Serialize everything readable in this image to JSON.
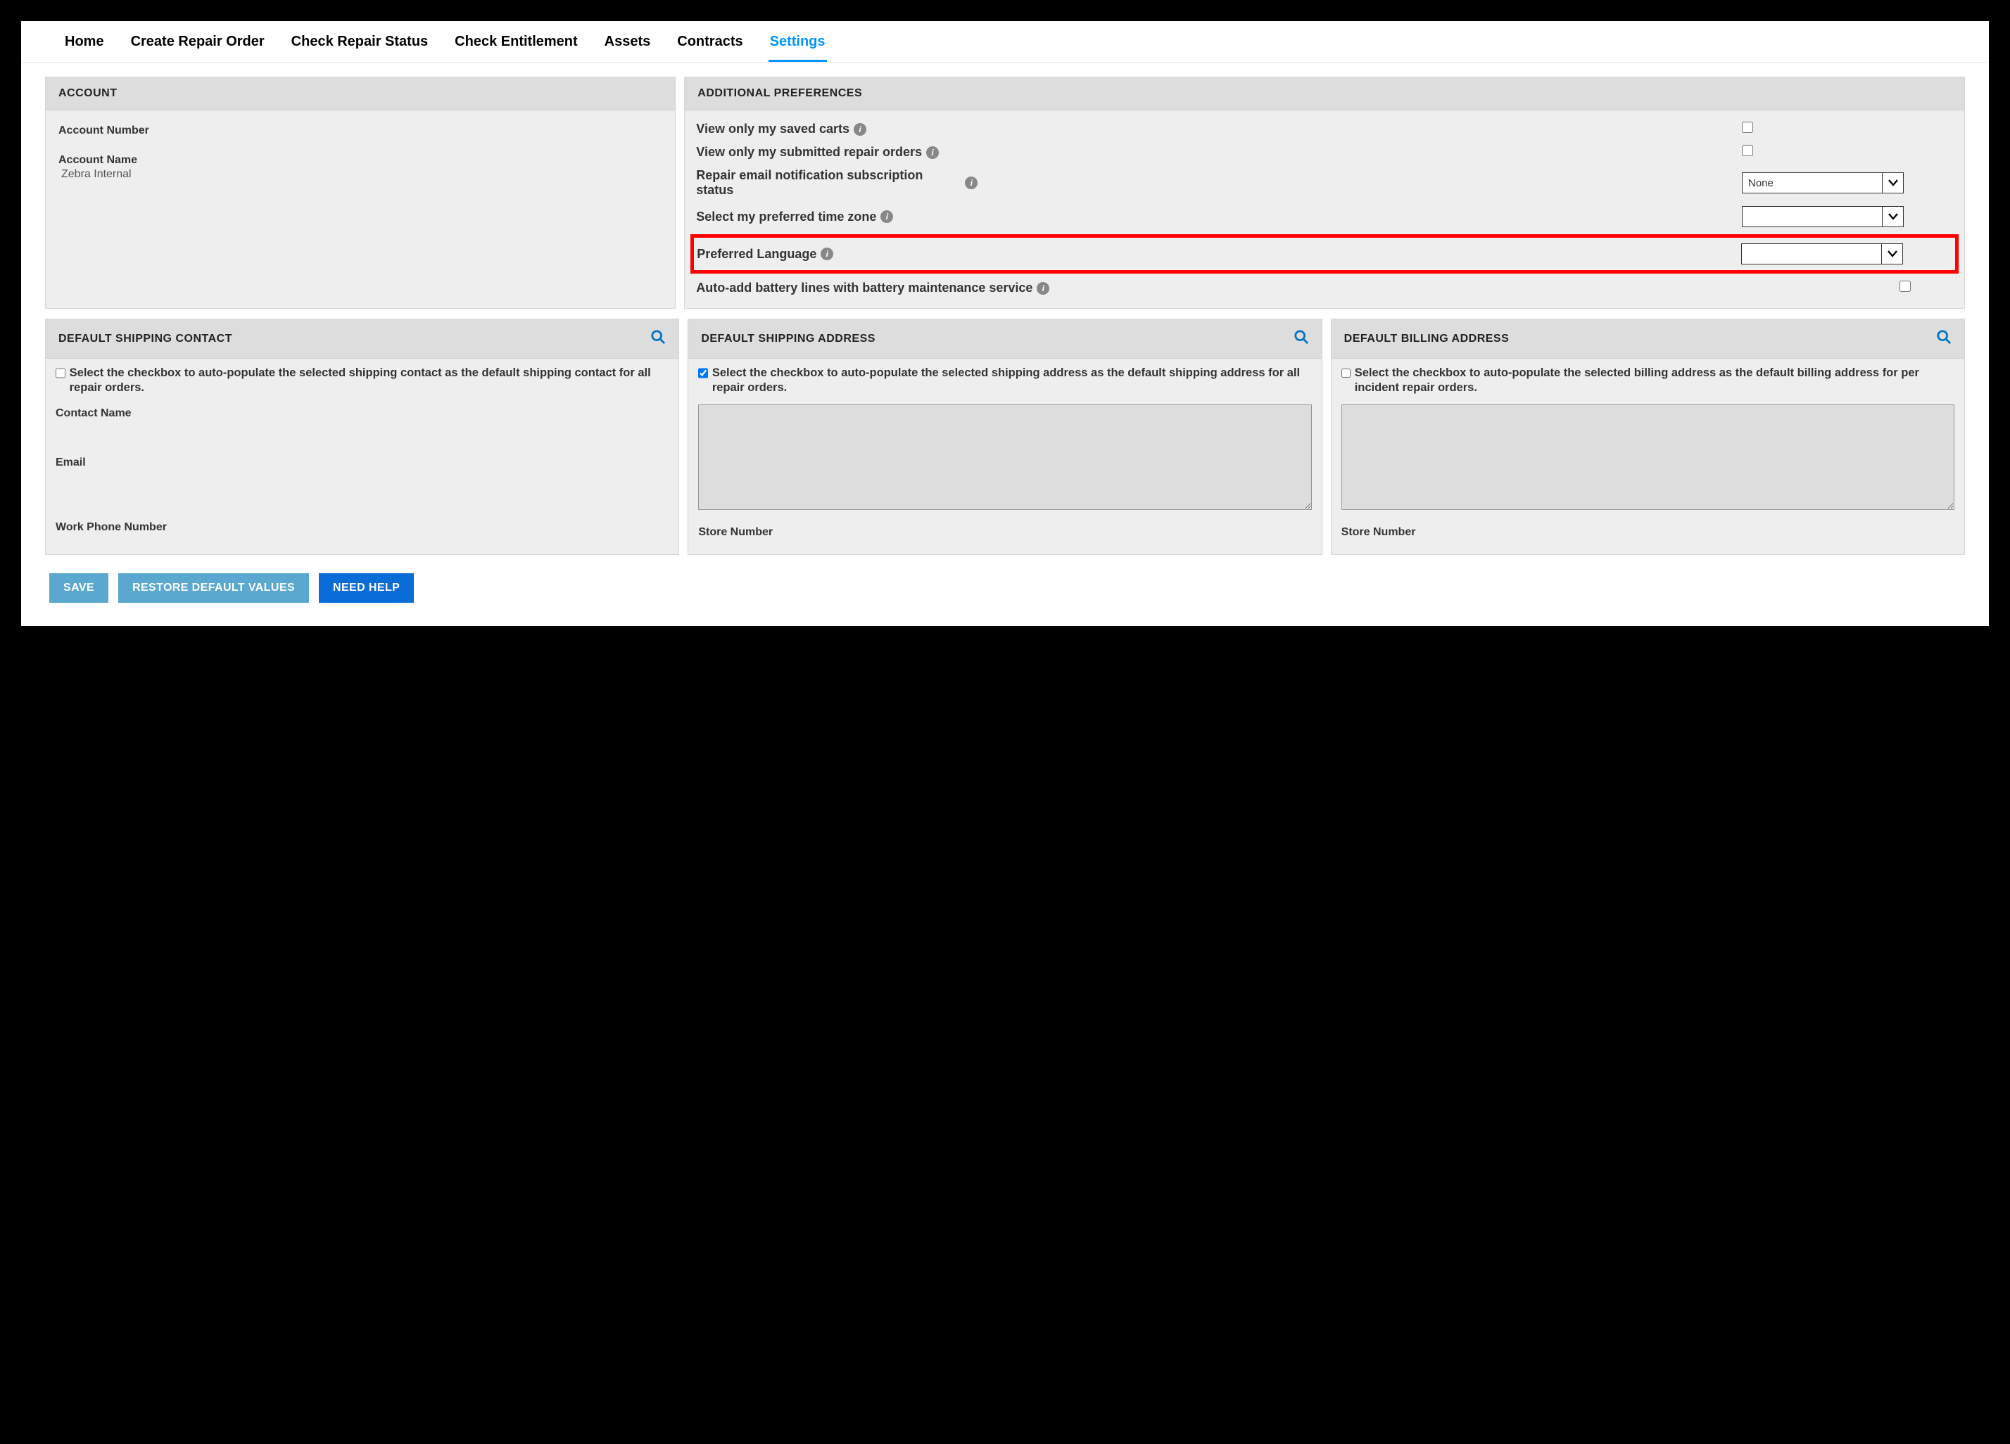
{
  "nav": {
    "items": [
      {
        "label": "Home",
        "active": false
      },
      {
        "label": "Create Repair Order",
        "active": false
      },
      {
        "label": "Check Repair Status",
        "active": false
      },
      {
        "label": "Check Entitlement",
        "active": false
      },
      {
        "label": "Assets",
        "active": false
      },
      {
        "label": "Contracts",
        "active": false
      },
      {
        "label": "Settings",
        "active": true
      }
    ]
  },
  "account": {
    "header": "ACCOUNT",
    "number_label": "Account Number",
    "number_value": "",
    "name_label": "Account Name",
    "name_value": "Zebra Internal"
  },
  "prefs": {
    "header": "ADDITIONAL PREFERENCES",
    "saved_carts_label": "View only my saved carts",
    "saved_carts_checked": false,
    "submitted_orders_label": "View only my submitted repair orders",
    "submitted_orders_checked": false,
    "email_status_label": "Repair email notification subscription status",
    "email_status_value": "None",
    "timezone_label": "Select my preferred time zone",
    "timezone_value": "",
    "language_label": "Preferred Language",
    "language_value": "",
    "battery_label": "Auto-add battery lines with battery maintenance service",
    "battery_checked": false
  },
  "shipping_contact": {
    "header": "DEFAULT SHIPPING CONTACT",
    "cb_text": "Select the checkbox to auto-populate the selected shipping contact as the default shipping contact for all repair orders.",
    "cb_checked": false,
    "contact_name_label": "Contact Name",
    "email_label": "Email",
    "phone_label": "Work Phone Number"
  },
  "shipping_address": {
    "header": "DEFAULT SHIPPING ADDRESS",
    "cb_text": "Select the checkbox to auto-populate the selected shipping address as the default shipping address for all repair orders.",
    "cb_checked": true,
    "store_label": "Store Number"
  },
  "billing_address": {
    "header": "DEFAULT BILLING ADDRESS",
    "cb_text": "Select the checkbox to auto-populate the selected billing address as the default billing address for per incident repair orders.",
    "cb_checked": false,
    "store_label": "Store Number"
  },
  "buttons": {
    "save": "SAVE",
    "restore": "RESTORE DEFAULT VALUES",
    "help": "NEED HELP"
  },
  "colors": {
    "accent": "#0096ff",
    "primary_button": "#0a6cd6",
    "light_button": "#5aa7cf",
    "highlight_border": "#ff0000"
  }
}
